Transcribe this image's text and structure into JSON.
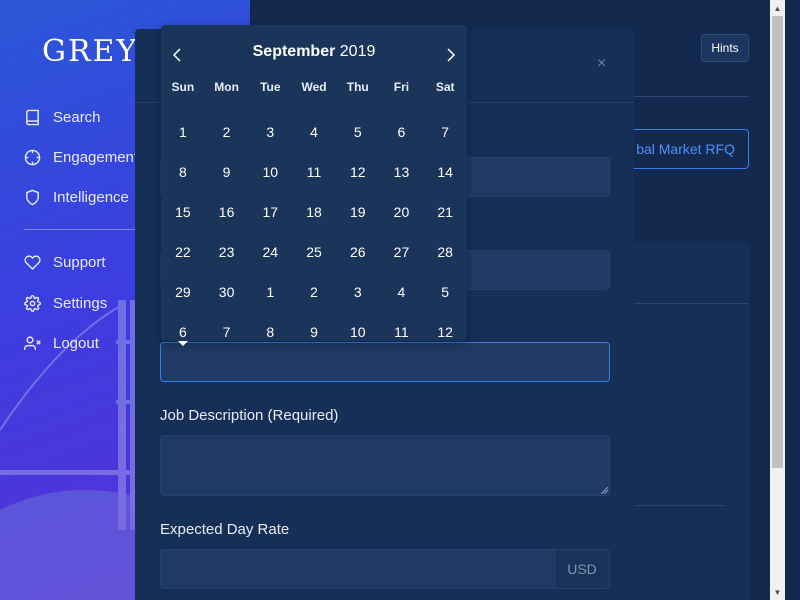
{
  "brand": {
    "logo": "GREYY"
  },
  "sidebar": {
    "items": [
      {
        "label": "Search",
        "icon": "book-icon"
      },
      {
        "label": "Engagement",
        "icon": "crosshair-icon"
      },
      {
        "label": "Intelligence",
        "icon": "shield-icon"
      },
      {
        "label": "Support",
        "icon": "heart-icon"
      },
      {
        "label": "Settings",
        "icon": "gear-icon"
      },
      {
        "label": "Logout",
        "icon": "user-x-icon"
      }
    ]
  },
  "header": {
    "hints_label": "Hints",
    "rfq_button": "bal Market RFQ"
  },
  "modal": {
    "close": "×",
    "job_description_label": "Job Description (Required)",
    "day_rate_label": "Expected Day Rate",
    "currency": "USD"
  },
  "datepicker": {
    "month": "September",
    "year": "2019",
    "weekdays": [
      "Sun",
      "Mon",
      "Tue",
      "Wed",
      "Thu",
      "Fri",
      "Sat"
    ],
    "weeks": [
      [
        "1",
        "2",
        "3",
        "4",
        "5",
        "6",
        "7"
      ],
      [
        "8",
        "9",
        "10",
        "11",
        "12",
        "13",
        "14"
      ],
      [
        "15",
        "16",
        "17",
        "18",
        "19",
        "20",
        "21"
      ],
      [
        "22",
        "23",
        "24",
        "25",
        "26",
        "27",
        "28"
      ],
      [
        "29",
        "30",
        "1",
        "2",
        "3",
        "4",
        "5"
      ],
      [
        "6",
        "7",
        "8",
        "9",
        "10",
        "11",
        "12"
      ]
    ]
  },
  "colors": {
    "accent": "#3a7bf0",
    "background": "#132a4e",
    "modal": "#162f57",
    "field": "#1f3a64"
  }
}
